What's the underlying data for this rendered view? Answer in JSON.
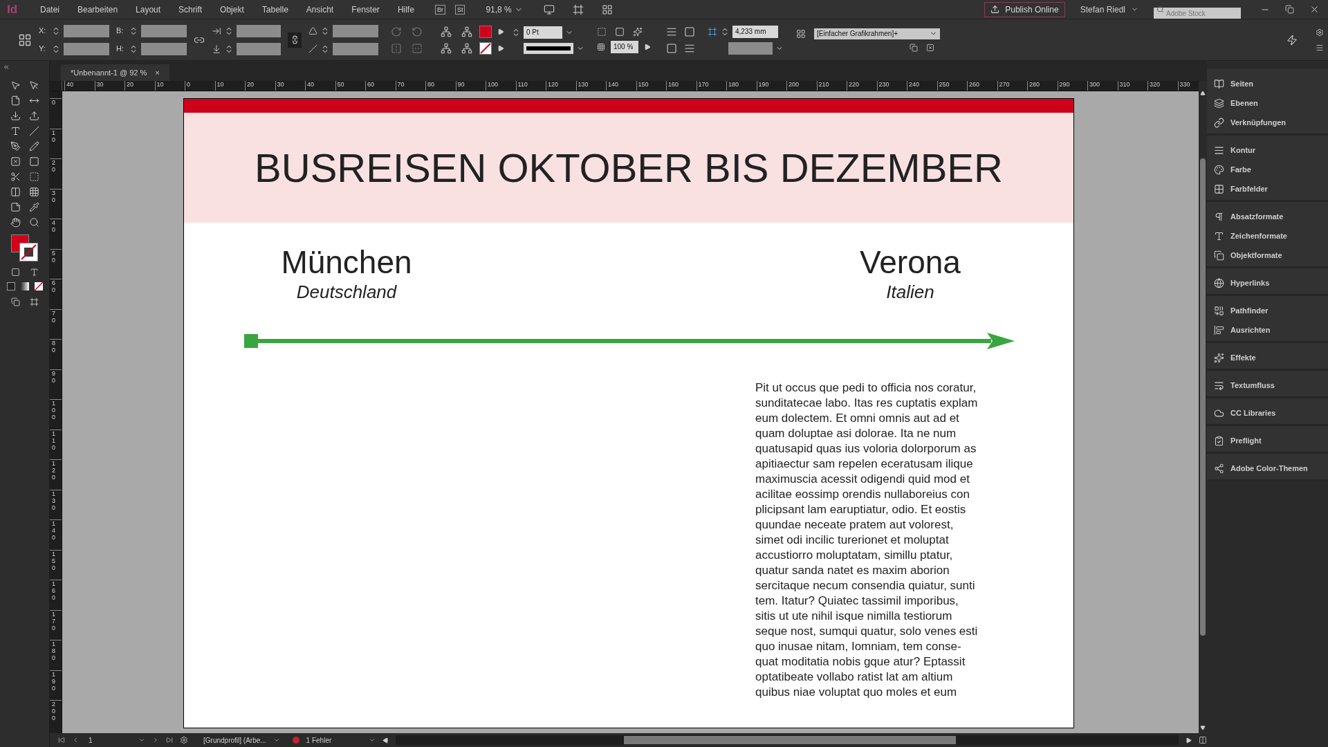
{
  "app": {
    "logo": "Id"
  },
  "menu": [
    "Datei",
    "Bearbeiten",
    "Layout",
    "Schrift",
    "Objekt",
    "Tabelle",
    "Ansicht",
    "Fenster",
    "Hilfe"
  ],
  "bridge_buttons": [
    "Br",
    "St"
  ],
  "zoom_level": "91,8 %",
  "publish_button": "Publish Online",
  "user": "Stefan Riedl",
  "stock_search": {
    "placeholder": "Adobe Stock"
  },
  "control_panel": {
    "x_label": "X:",
    "y_label": "Y:",
    "w_label": "B:",
    "h_label": "H:",
    "stroke_weight": "0 Pt",
    "opacity": "100 %",
    "offset": "4,233 mm",
    "object_style": "[Einfacher Grafikrahmen]+"
  },
  "document_tab": {
    "title": "*Unbenannt-1 @ 92 %",
    "close": "×"
  },
  "horizontal_ruler": [
    "40",
    "30",
    "20",
    "10",
    "0",
    "10",
    "20",
    "30",
    "40",
    "50",
    "60",
    "70",
    "80",
    "90",
    "100",
    "110",
    "120",
    "130",
    "140",
    "150",
    "160",
    "170",
    "180",
    "190",
    "200",
    "210",
    "220",
    "230",
    "240",
    "250",
    "260",
    "270",
    "280",
    "290",
    "300",
    "310",
    "320",
    "330"
  ],
  "vertical_ruler": [
    "0",
    "10",
    "20",
    "30",
    "40",
    "50",
    "60",
    "70",
    "80",
    "90",
    "100",
    "110",
    "120",
    "130",
    "140",
    "150",
    "160",
    "170",
    "180",
    "190",
    "200"
  ],
  "page": {
    "title": "BUSREISEN OKTOBER BIS DEZEMBER",
    "origin": {
      "city": "München",
      "country": "Deutschland"
    },
    "destination": {
      "city": "Verona",
      "country": "Italien"
    },
    "body_lines": [
      "Pit ut occus que pedi to officia nos coratur,",
      "sunditatecae labo. Itas res cuptatis explam",
      "eum dolectem. Et omni omnis aut ad et",
      "quam doluptae asi dolorae. Ita ne num",
      "quatusapid quas ius voloria dolorporum as",
      "apitiaectur sam repelen eceratusam ilique",
      "maximuscia acessit odigendi quid mod et",
      "acilitae eossimp orendis nullaboreius con",
      "plicipsant lam earuptiatur, odio. Et eostis",
      "quundae neceate pratem aut volorest,",
      "simet odi incilic turerionet et moluptat",
      "accustiorro moluptatam, simillu ptatur,",
      "quatur sanda natet es maxim aborion",
      "sercitaque necum consendia quiatur, sunti",
      "tem. Itatur? Quiatec tassimil imporibus,",
      "sitis ut ute nihil isque nimilla testiorum",
      "seque nost, sumqui quatur, solo venes esti",
      "quo inusae nitam, Iomniam, tem conse-",
      "quat moditatia nobis gque atur? Eptassit",
      "optatibeate vollabo ratist lat am altium",
      "quibus niae voluptat quo moles et eum"
    ]
  },
  "panels": [
    {
      "items": [
        {
          "label": "Seiten",
          "kind": "pages"
        },
        {
          "label": "Ebenen",
          "kind": "layers"
        },
        {
          "label": "Verknüpfungen",
          "kind": "links"
        }
      ]
    },
    {
      "items": [
        {
          "label": "Kontur",
          "kind": "stroke"
        },
        {
          "label": "Farbe",
          "kind": "color"
        },
        {
          "label": "Farbfelder",
          "kind": "swatches"
        }
      ]
    },
    {
      "items": [
        {
          "label": "Absatzformate",
          "kind": "paragraph"
        },
        {
          "label": "Zeichenformate",
          "kind": "character"
        },
        {
          "label": "Objektformate",
          "kind": "object"
        }
      ]
    },
    {
      "items": [
        {
          "label": "Hyperlinks",
          "kind": "hyperlinks"
        }
      ]
    },
    {
      "items": [
        {
          "label": "Pathfinder",
          "kind": "pathfinder"
        },
        {
          "label": "Ausrichten",
          "kind": "align"
        }
      ]
    },
    {
      "items": [
        {
          "label": "Effekte",
          "kind": "effects"
        }
      ]
    },
    {
      "items": [
        {
          "label": "Textumfluss",
          "kind": "wrap"
        }
      ]
    },
    {
      "items": [
        {
          "label": "CC Libraries",
          "kind": "libraries"
        }
      ]
    },
    {
      "items": [
        {
          "label": "Preflight",
          "kind": "preflight"
        }
      ]
    },
    {
      "items": [
        {
          "label": "Adobe Color-Themen",
          "kind": "themes"
        }
      ]
    }
  ],
  "status_bar": {
    "page": "1",
    "profile": "[Grundprofil] (Arbe...",
    "errors": "1 Fehler"
  }
}
